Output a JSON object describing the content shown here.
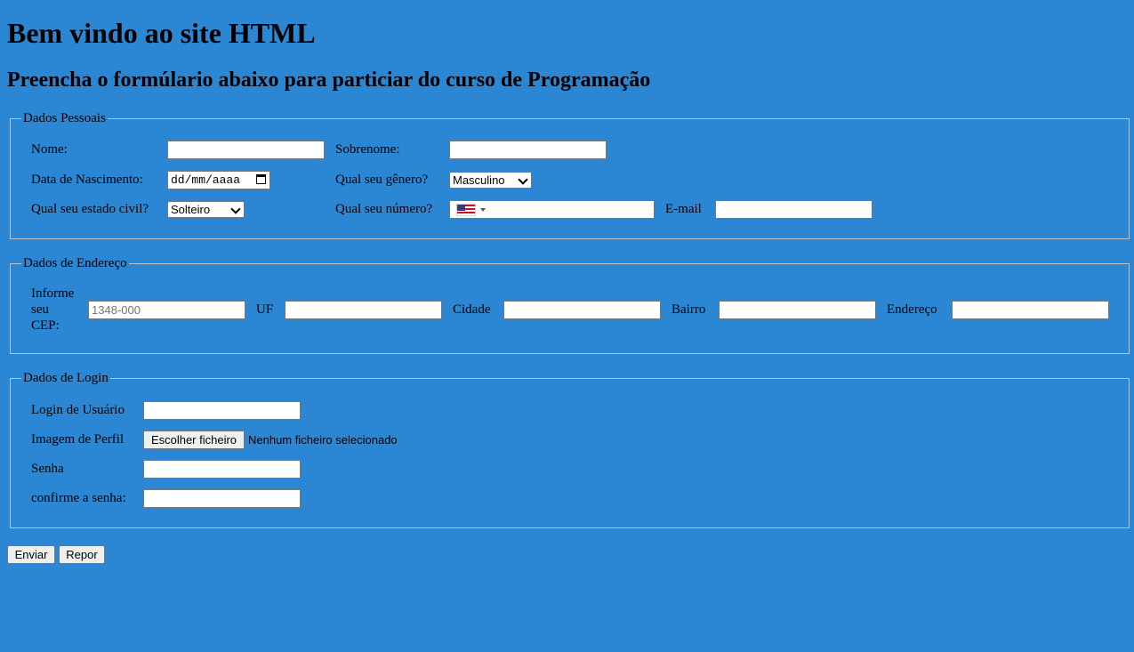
{
  "page": {
    "title": "Bem vindo ao site HTML",
    "subtitle": "Preencha o formúlario abaixo para particiar do curso de Programação",
    "background_color": "#2b87d3"
  },
  "personal": {
    "legend": "Dados Pessoais",
    "name_label": "Nome:",
    "surname_label": "Sobrenome:",
    "birth_label": "Data de Nascimento:",
    "birth_placeholder": "dd/mm/aaaa",
    "gender_label": "Qual seu gênero?",
    "gender_selected": "Masculino",
    "civil_label": "Qual seu estado civil?",
    "civil_selected": "Solteiro",
    "phone_label": "Qual seu número?",
    "phone_country_icon": "us-flag-icon",
    "email_label": "E-mail"
  },
  "address": {
    "legend": "Dados de Endereço",
    "cep_label_1": "Informe",
    "cep_label_2": "seu",
    "cep_label_3": "CEP:",
    "cep_placeholder": "1348-000",
    "uf_label": "UF",
    "city_label": "Cidade",
    "district_label": "Bairro",
    "street_label": "Endereço"
  },
  "login": {
    "legend": "Dados de Login",
    "user_label": "Login de Usuário",
    "image_label": "Imagem de Perfil",
    "file_button": "Escolher ficheiro",
    "file_status": "Nenhum ficheiro selecionado",
    "password_label": "Senha",
    "confirm_label": "confirme a senha:"
  },
  "actions": {
    "submit_label": "Enviar",
    "reset_label": "Repor"
  }
}
